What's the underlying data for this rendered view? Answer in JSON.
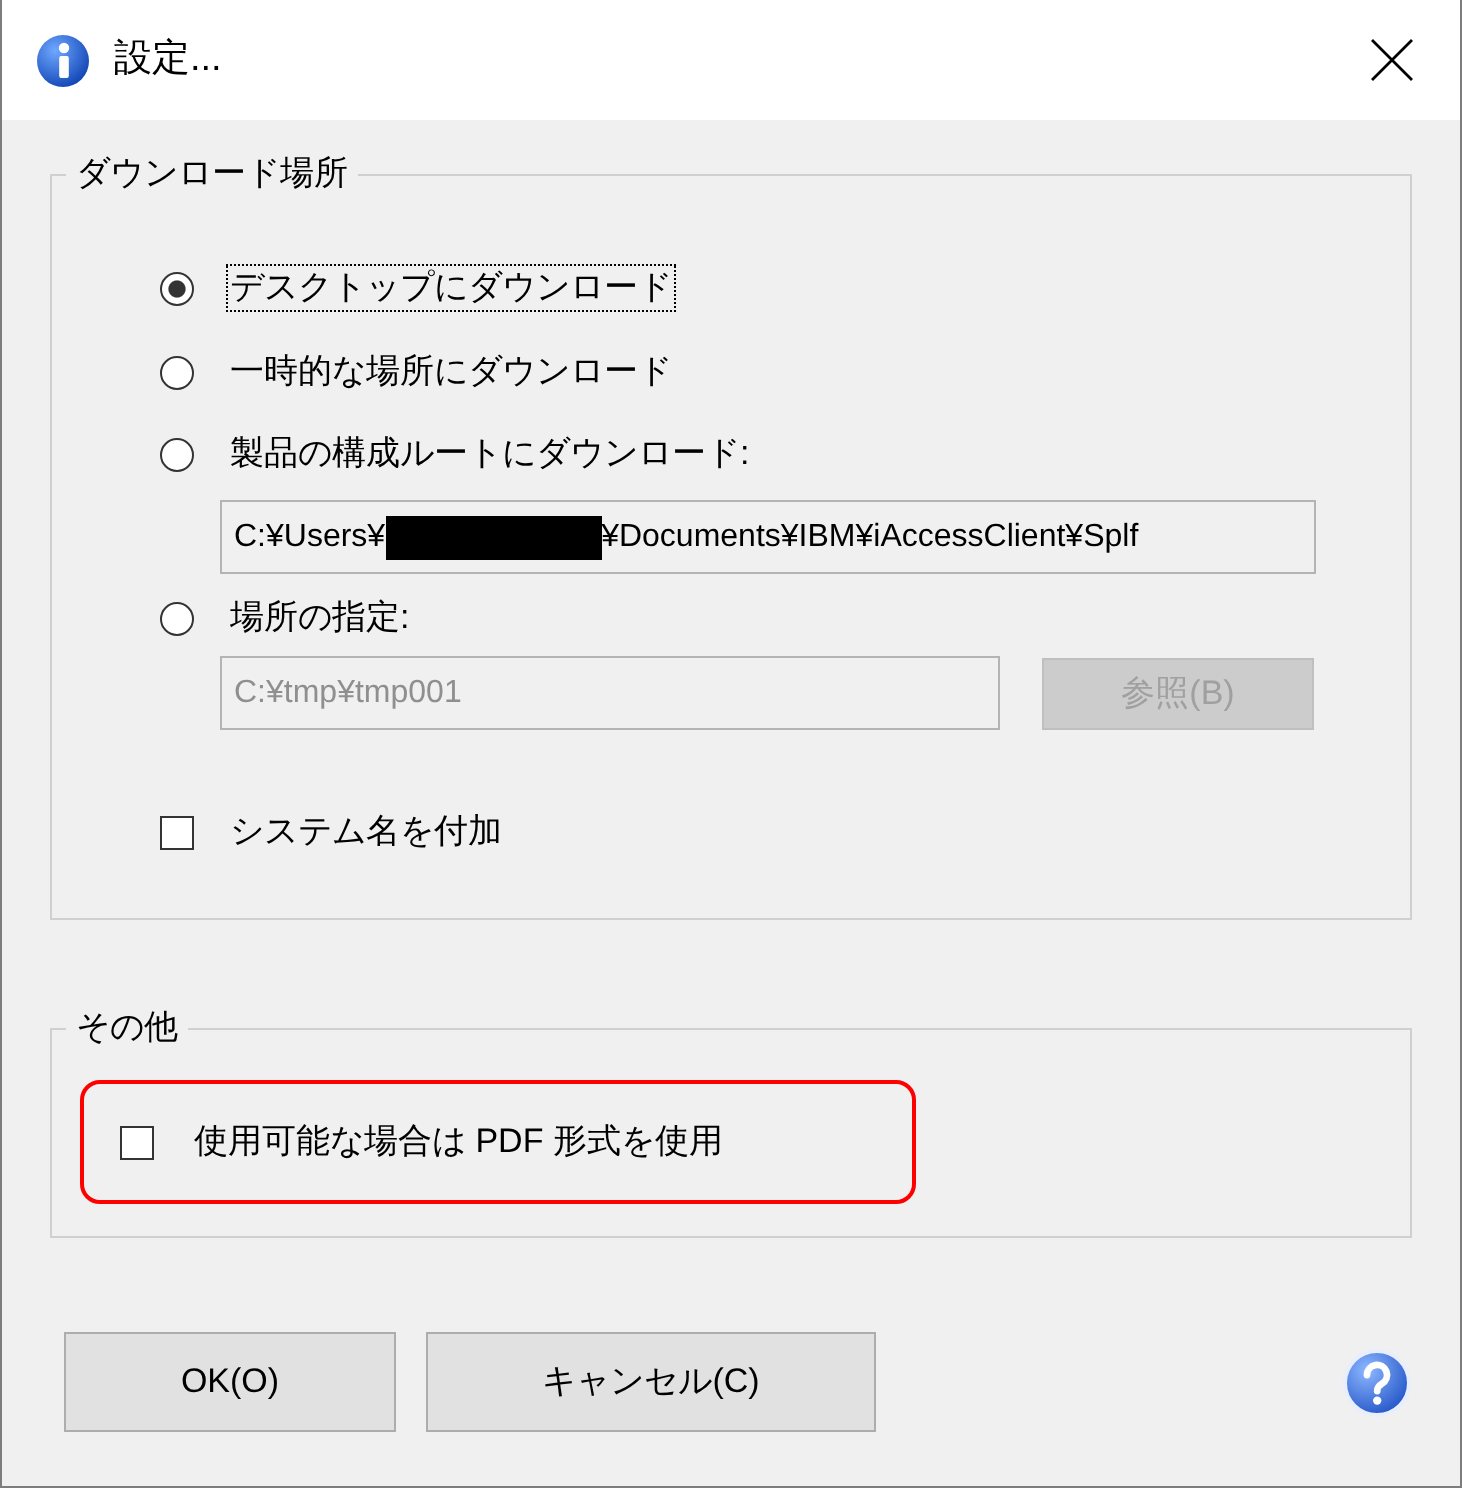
{
  "window": {
    "title": "設定..."
  },
  "download_group": {
    "legend": "ダウンロード場所",
    "options": [
      {
        "label": "デスクトップにダウンロード",
        "selected": true,
        "focused": true
      },
      {
        "label": "一時的な場所にダウンロード",
        "selected": false,
        "focused": false
      },
      {
        "label": "製品の構成ルートにダウンロード:",
        "selected": false,
        "focused": false,
        "path_field": {
          "value_before": "C:¥Users¥",
          "redacted": true,
          "value_after": "¥Documents¥IBM¥iAccessClient¥Splf",
          "disabled": false
        }
      },
      {
        "label": "場所の指定:",
        "selected": false,
        "focused": false,
        "path_field": {
          "value": "C:¥tmp¥tmp001",
          "disabled": true
        },
        "browse_button": {
          "label": "参照(B)",
          "disabled": true
        }
      }
    ],
    "append_system_name": {
      "label": "システム名を付加",
      "checked": false
    }
  },
  "other_group": {
    "legend": "その他",
    "options": [
      {
        "label": "使用可能な場合は PDF 形式を使用",
        "checked": false,
        "highlighted": true
      }
    ]
  },
  "buttons": [
    {
      "label": "OK(O)"
    },
    {
      "label": "キャンセル(C)"
    }
  ]
}
